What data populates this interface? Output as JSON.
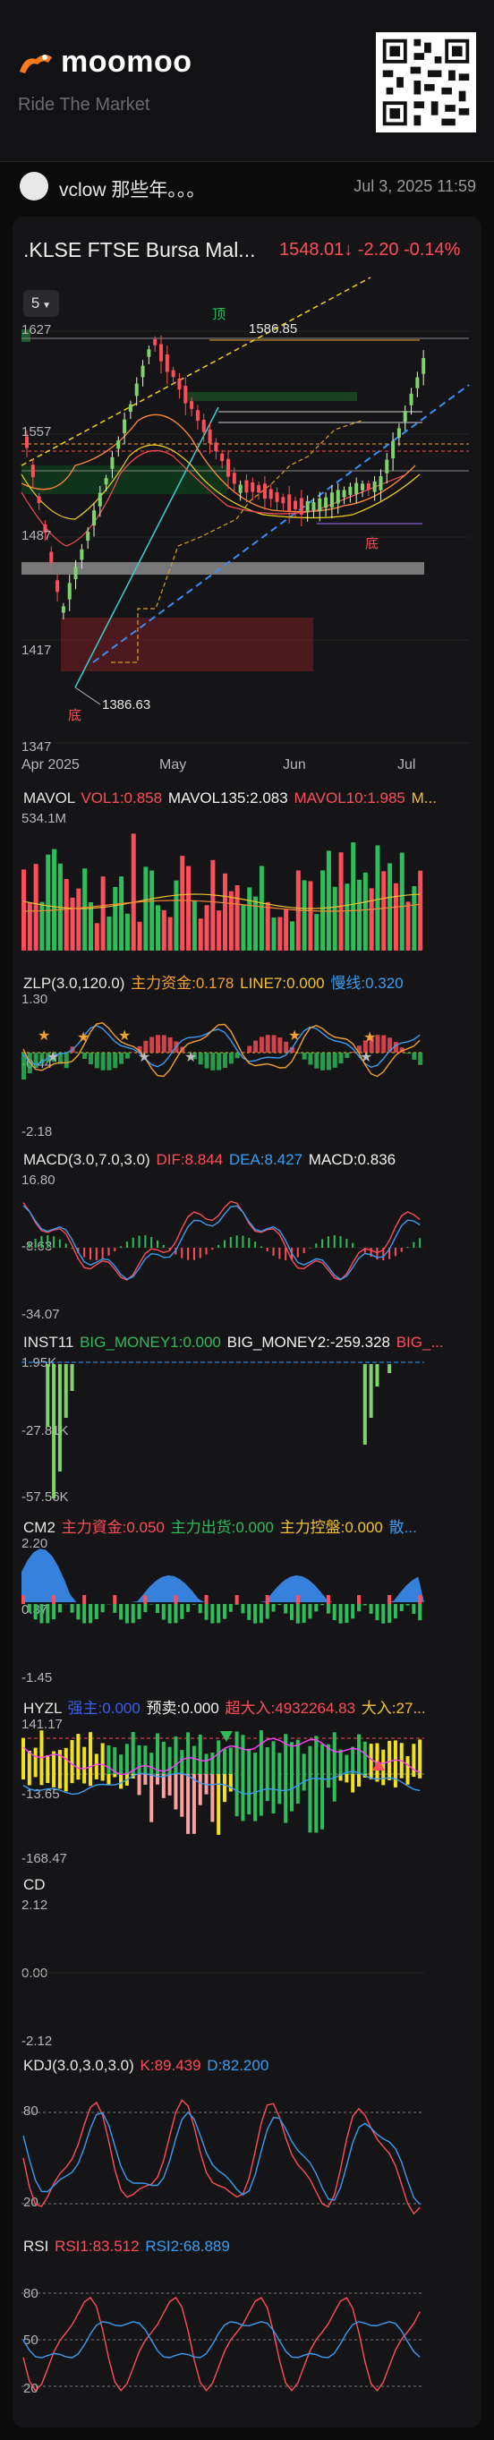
{
  "header": {
    "brand": "moomoo",
    "tagline": "Ride The Market"
  },
  "post": {
    "username": "vclow 那些年。。。",
    "datetime": "Jul 3, 2025 11:59"
  },
  "quote": {
    "ticker": ".KLSE FTSE Bursa Mal...",
    "price": "1548.01",
    "change": "-2.20",
    "change_pct": "-0.14%",
    "arrow": "↓",
    "period": "5",
    "down_color": "#ff4d5a",
    "up_color": "#2dbd5a"
  },
  "main_chart": {
    "y_ticks": [
      "1627",
      "1557",
      "1487",
      "1417",
      "1347"
    ],
    "x_ticks": [
      "Apr 2025",
      "May",
      "Jun",
      "Jul"
    ],
    "annotations": {
      "high": "1586.85",
      "low": "1386.63",
      "top_mark": "顶",
      "bottom_mark_1": "底",
      "bottom_mark_2": "底"
    }
  },
  "panels": {
    "mavol": {
      "name": "MAVOL",
      "items": [
        {
          "label": "VOL1:0.858",
          "color": "#ff4d5a"
        },
        {
          "label": "MAVOL135:2.083",
          "color": "#f2f2f2"
        },
        {
          "label": "MAVOL10:1.985",
          "color": "#ff4d5a"
        },
        {
          "label": "M...",
          "color": "#f2c230"
        }
      ],
      "y_ticks": [
        "534.1M"
      ]
    },
    "zlp": {
      "name": "ZLP(3.0,120.0)",
      "items": [
        {
          "label": "主力资金:0.178",
          "color": "#f2a030"
        },
        {
          "label": "LINE7:0.000",
          "color": "#f2c230"
        },
        {
          "label": "慢线:0.320",
          "color": "#3a9df2"
        }
      ],
      "y_ticks": [
        "1.30",
        "-0.44",
        "-2.18"
      ]
    },
    "macd": {
      "name": "MACD(3.0,7.0,3.0)",
      "items": [
        {
          "label": "DIF:8.844",
          "color": "#ff4d5a"
        },
        {
          "label": "DEA:8.427",
          "color": "#3a9df2"
        },
        {
          "label": "MACD:0.836",
          "color": "#f2f2f2"
        }
      ],
      "y_ticks": [
        "16.80",
        "-8.63",
        "-34.07"
      ]
    },
    "inst": {
      "name": "INST11",
      "items": [
        {
          "label": "BIG_MONEY1:0.000",
          "color": "#2dbd5a"
        },
        {
          "label": "BIG_MONEY2:-259.328",
          "color": "#f2f2f2"
        },
        {
          "label": "BIG_...",
          "color": "#ff4d5a"
        }
      ],
      "y_ticks": [
        "1.95K",
        "-27.81K",
        "-57.56K"
      ]
    },
    "cm2": {
      "name": "CM2",
      "items": [
        {
          "label": "主力資金:0.050",
          "color": "#ff4d5a"
        },
        {
          "label": "主力出货:0.000",
          "color": "#2dbd5a"
        },
        {
          "label": "主力控盤:0.000",
          "color": "#f2c230"
        },
        {
          "label": "散...",
          "color": "#3a9df2"
        }
      ],
      "y_ticks": [
        "2.20",
        "0.37",
        "-1.45"
      ]
    },
    "hyzl": {
      "name": "HYZL",
      "items": [
        {
          "label": "强主:0.000",
          "color": "#3a5df2"
        },
        {
          "label": "预卖:0.000",
          "color": "#f2f2f2"
        },
        {
          "label": "超大入:4932264.83",
          "color": "#ff4d5a"
        },
        {
          "label": "大入:27...",
          "color": "#f2c230"
        }
      ],
      "y_ticks": [
        "141.17",
        "-13.65",
        "-168.47"
      ]
    },
    "cd": {
      "name": "CD",
      "items": [],
      "y_ticks": [
        "2.12",
        "0.00",
        "-2.12"
      ]
    },
    "kdj": {
      "name": "KDJ(3.0,3.0,3.0)",
      "items": [
        {
          "label": "K:89.439",
          "color": "#ff4d5a"
        },
        {
          "label": "D:82.200",
          "color": "#3a9df2"
        }
      ],
      "y_ticks": [
        "80",
        "20"
      ]
    },
    "rsi": {
      "name": "RSI",
      "items": [
        {
          "label": "RSI1:83.512",
          "color": "#ff4d5a"
        },
        {
          "label": "RSI2:68.889",
          "color": "#3a9df2"
        }
      ],
      "y_ticks": [
        "80",
        "50",
        "20"
      ]
    }
  }
}
